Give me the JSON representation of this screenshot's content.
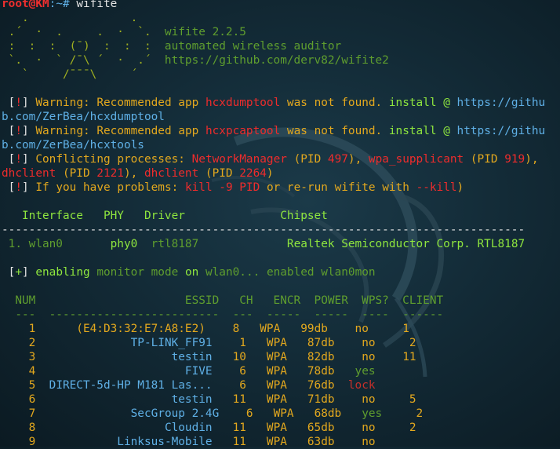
{
  "prompt": {
    "user": "root@KM",
    "path": ":~#",
    "command": " wifite"
  },
  "logo": {
    "art": [
      "   .               .",
      " .´  ·  .     .  ·  `.",
      " :  :  :  (¯)  :  :  :",
      " `.  ·  ` /¯\\ ´  ·  .´",
      "   `     /¯¯¯\\     ´"
    ],
    "art_suffix_1": "  wifite 2.2.5",
    "art_suffix_2": "  automated wireless auditor",
    "art_suffix_3": "  https://github.com/derv82/wifite2"
  },
  "warnings": [
    {
      "bang": "!",
      "label": " Warning: Recommended app ",
      "app": "hcxdumptool",
      "mid": " was not found. ",
      "install": "install @",
      "url_a": " https://githu",
      "url_b": "b.com/ZerBea/hcxdumptool"
    },
    {
      "bang": "!",
      "label": " Warning: Recommended app ",
      "app": "hcxpcaptool",
      "mid": " was not found. ",
      "install": "install @",
      "url_a": " https://githu",
      "url_b": "b.com/ZerBea/hcxtools"
    }
  ],
  "conflict": {
    "bang": "!",
    "label": " Conflicting processes: ",
    "p1": "NetworkManager",
    "p1_pid_open": " (PID ",
    "p1_pid": "497",
    "p1_close": "), ",
    "p2": "wpa_supplicant",
    "p2_pid_open": " (PID ",
    "p2_pid": "919",
    "p2_close": "), ",
    "p3": "dhclient",
    "p3_pid_open": " (PID ",
    "p3_pid": "2121",
    "p3_close": "), ",
    "p4": "dhclient",
    "p4_pid_open": " (PID ",
    "p4_pid": "2264",
    "p4_close": ")"
  },
  "problems": {
    "bang": "!",
    "label": " If you have problems: ",
    "cmd": "kill -9 PID",
    "mid": " or re-run wifite with ",
    "flag": "--kill",
    "end": ")"
  },
  "iface_table": {
    "header": "   Interface   PHY   Driver              Chipset",
    "divider": "-----------------------------------------------------------------------------",
    "row_num": " 1. wlan0       ",
    "row_phy": "phy0",
    "row_gap": "  ",
    "row_driver": "rtl8187",
    "row_gap2": "             ",
    "row_chipset": "Realtek Semiconductor Corp. RTL8187"
  },
  "monitor": {
    "plus": "+",
    "enabling": " enabling",
    "monitor_mode": " monitor mode ",
    "on": "on",
    "iface": " wlan0...",
    "enabled": " enabled ",
    "mon_iface": "wlan0mon"
  },
  "targets": {
    "header": "  NUM                      ESSID   CH   ENCR  POWER  WPS?  CLIENT",
    "divider": "  ---  -------------------------  ---  -----  -----  ----  ------",
    "rows": [
      {
        "num": "    1",
        "essid": "      (E4:D3:32:E7:A8:E2)",
        "ch": "    8",
        "encr": "   WPA",
        "power": "   99db",
        "wps": "    no",
        "wps_kind": "no",
        "client": "     1"
      },
      {
        "num": "    2",
        "essid": "              TP-LINK_FF91",
        "ch": "    1",
        "encr": "   WPA",
        "power": "   87db",
        "wps": "    no",
        "wps_kind": "no",
        "client": "     2"
      },
      {
        "num": "    3",
        "essid": "                    testin",
        "ch": "   10",
        "encr": "   WPA",
        "power": "   82db",
        "wps": "    no",
        "wps_kind": "no",
        "client": "    11"
      },
      {
        "num": "    4",
        "essid": "                      FIVE",
        "ch": "    6",
        "encr": "   WPA",
        "power": "   78db",
        "wps": "   yes",
        "wps_kind": "yes",
        "client": ""
      },
      {
        "num": "    5",
        "essid": "  DIRECT-5d-HP M181 Las...",
        "ch": "    6",
        "encr": "   WPA",
        "power": "   76db",
        "wps": "  lock",
        "wps_kind": "lock",
        "client": ""
      },
      {
        "num": "    6",
        "essid": "                    testin",
        "ch": "   11",
        "encr": "   WPA",
        "power": "   71db",
        "wps": "    no",
        "wps_kind": "no",
        "client": "     5"
      },
      {
        "num": "    7",
        "essid": "              SecGroup 2.4G",
        "ch": "    6",
        "encr": "   WPA",
        "power": "   68db",
        "wps": "   yes",
        "wps_kind": "yes",
        "client": "     2"
      },
      {
        "num": "    8",
        "essid": "                   Cloudin",
        "ch": "   11",
        "encr": "   WPA",
        "power": "   65db",
        "wps": "    no",
        "wps_kind": "no",
        "client": "     2"
      },
      {
        "num": "    9",
        "essid": "            Linksus-Mobile",
        "ch": "   11",
        "encr": "   WPA",
        "power": "   63db",
        "wps": "    no",
        "wps_kind": "no",
        "client": ""
      }
    ]
  },
  "colors": {
    "background": "#132b37",
    "prompt_red": "#ef2f2f",
    "green": "#7fcc3a",
    "orange": "#e3a81e",
    "red": "#ee2c2c",
    "blue": "#5fb0e6"
  }
}
